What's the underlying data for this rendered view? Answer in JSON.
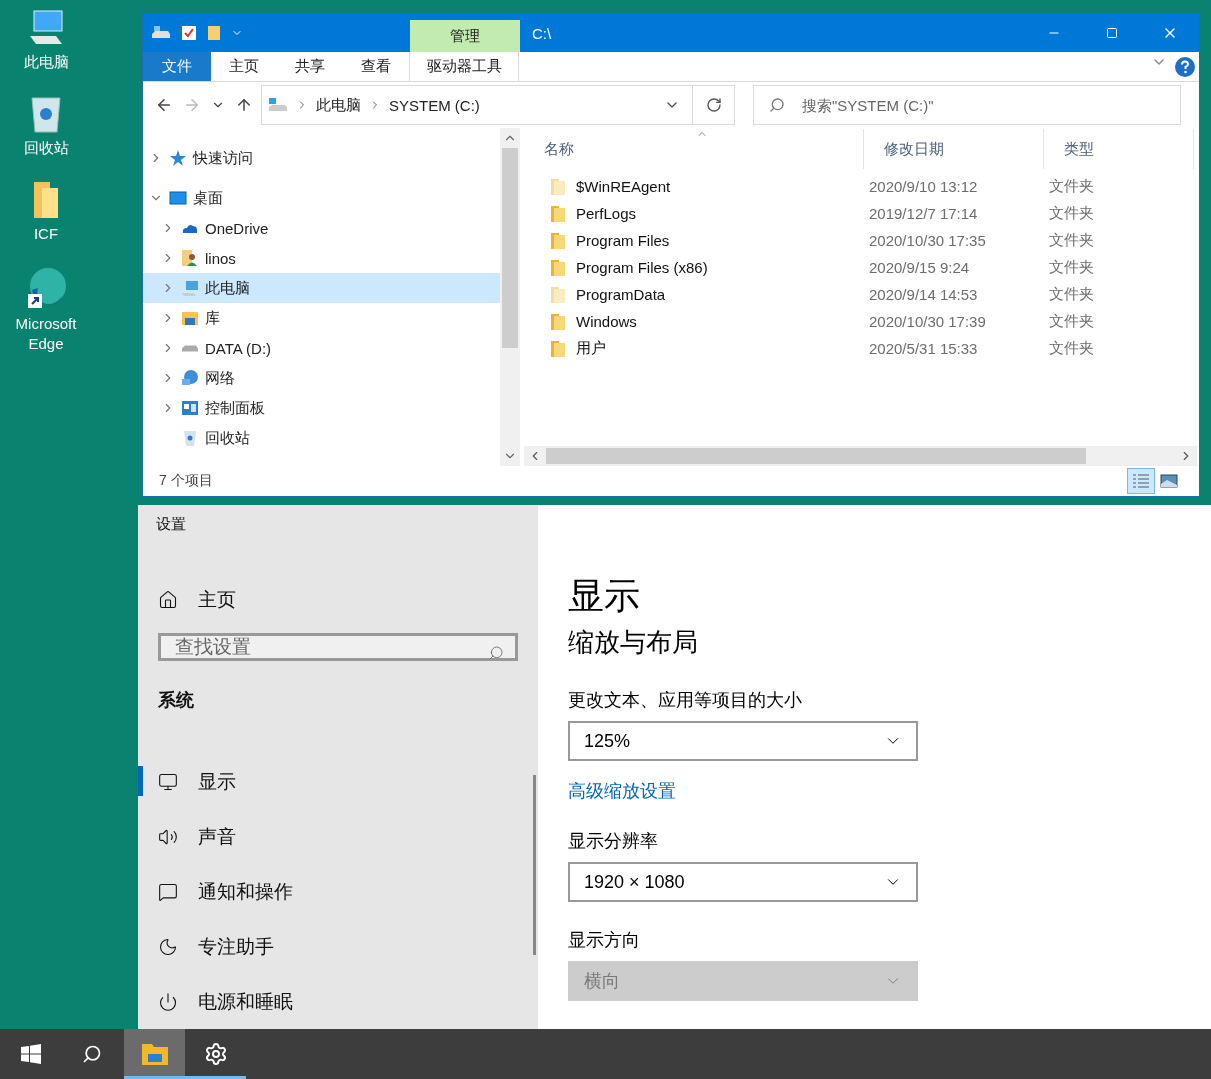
{
  "desktop_icons": [
    {
      "label": "此电脑",
      "kind": "computer"
    },
    {
      "label": "回收站",
      "kind": "recycle"
    },
    {
      "label": "ICF",
      "kind": "folder"
    },
    {
      "label": "Microsoft Edge",
      "kind": "edge"
    }
  ],
  "explorer": {
    "title": "C:\\",
    "context_group": "管理",
    "tabs": [
      {
        "label": "文件",
        "kind": "file"
      },
      {
        "label": "主页",
        "kind": "normal"
      },
      {
        "label": "共享",
        "kind": "normal"
      },
      {
        "label": "查看",
        "kind": "normal"
      },
      {
        "label": "驱动器工具",
        "kind": "context"
      }
    ],
    "breadcrumbs": [
      "此电脑",
      "SYSTEM (C:)"
    ],
    "search": {
      "placeholder": "搜索\"SYSTEM (C:)\""
    },
    "nav": [
      {
        "label": "快速访问",
        "kind": "star",
        "expanded": false,
        "selected": false
      },
      {
        "label": "桌面",
        "kind": "desktop",
        "expanded": true,
        "selected": false,
        "children": [
          {
            "label": "OneDrive",
            "kind": "cloud",
            "expanded": false,
            "selected": false
          },
          {
            "label": "linos",
            "kind": "user",
            "expanded": false,
            "selected": false
          },
          {
            "label": "此电脑",
            "kind": "computer",
            "expanded": false,
            "selected": true
          },
          {
            "label": "库",
            "kind": "library",
            "expanded": false,
            "selected": false
          },
          {
            "label": "DATA (D:)",
            "kind": "drive",
            "expanded": false,
            "selected": false
          },
          {
            "label": "网络",
            "kind": "network",
            "expanded": false,
            "selected": false
          },
          {
            "label": "控制面板",
            "kind": "control",
            "expanded": false,
            "selected": false
          },
          {
            "label": "回收站",
            "kind": "recycle",
            "selected": false
          }
        ]
      }
    ],
    "columns": [
      "名称",
      "修改日期",
      "类型"
    ],
    "rows": [
      {
        "name": "$WinREAgent",
        "date": "2020/9/10 13:12",
        "type": "文件夹",
        "hidden": true
      },
      {
        "name": "PerfLogs",
        "date": "2019/12/7 17:14",
        "type": "文件夹",
        "hidden": false
      },
      {
        "name": "Program Files",
        "date": "2020/10/30 17:35",
        "type": "文件夹",
        "hidden": false
      },
      {
        "name": "Program Files (x86)",
        "date": "2020/9/15 9:24",
        "type": "文件夹",
        "hidden": false
      },
      {
        "name": "ProgramData",
        "date": "2020/9/14 14:53",
        "type": "文件夹",
        "hidden": true
      },
      {
        "name": "Windows",
        "date": "2020/10/30 17:39",
        "type": "文件夹",
        "hidden": false
      },
      {
        "name": "用户",
        "date": "2020/5/31 15:33",
        "type": "文件夹",
        "hidden": false
      }
    ],
    "status": "7 个项目",
    "views": [
      {
        "kind": "details",
        "selected": true
      },
      {
        "kind": "large",
        "selected": false
      }
    ]
  },
  "settings": {
    "title": "设置",
    "home": "主页",
    "search": {
      "placeholder": "查找设置"
    },
    "section": "系统",
    "nav": [
      {
        "label": "显示",
        "kind": "display",
        "selected": true
      },
      {
        "label": "声音",
        "kind": "sound",
        "selected": false
      },
      {
        "label": "通知和操作",
        "kind": "notify",
        "selected": false
      },
      {
        "label": "专注助手",
        "kind": "focus",
        "selected": false
      },
      {
        "label": "电源和睡眠",
        "kind": "power",
        "selected": false
      }
    ],
    "heading": "显示",
    "subheading": "缩放与布局",
    "controls": [
      {
        "kind": "dropdown",
        "label": "更改文本、应用等项目的大小",
        "value": "125%",
        "disabled": false
      },
      {
        "kind": "link",
        "label": "高级缩放设置"
      },
      {
        "kind": "dropdown",
        "label": "显示分辨率",
        "value": "1920 × 1080",
        "disabled": false
      },
      {
        "kind": "dropdown",
        "label": "显示方向",
        "value": "横向",
        "disabled": true
      }
    ]
  },
  "taskbar": [
    {
      "kind": "start",
      "active": false,
      "running": false
    },
    {
      "kind": "search",
      "active": false,
      "running": false
    },
    {
      "kind": "explorer",
      "active": true,
      "running": true
    },
    {
      "kind": "settings",
      "active": false,
      "running": true
    }
  ]
}
